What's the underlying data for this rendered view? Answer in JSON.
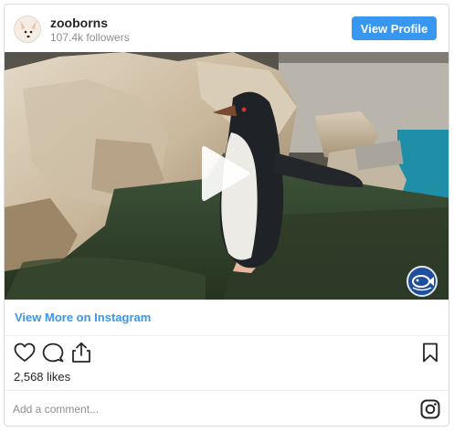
{
  "header": {
    "username": "zooborns",
    "followers": "107.4k followers",
    "view_profile_label": "View Profile",
    "avatar_icon": "fox-avatar-icon"
  },
  "media": {
    "type": "video",
    "play_icon": "play-icon",
    "watermark_icon": "aquarium-fish-logo-icon"
  },
  "links": {
    "view_more_label": "View More on Instagram"
  },
  "actions": {
    "icons": [
      "heart-icon",
      "comment-icon",
      "share-icon",
      "bookmark-icon"
    ],
    "likes": "2,568 likes"
  },
  "comment": {
    "placeholder": "Add a comment...",
    "value": "",
    "brand_icon": "instagram-icon"
  },
  "colors": {
    "accent": "#3897f0",
    "border": "#dbdbdb",
    "text": "#262626",
    "muted": "#8e8e8e"
  }
}
